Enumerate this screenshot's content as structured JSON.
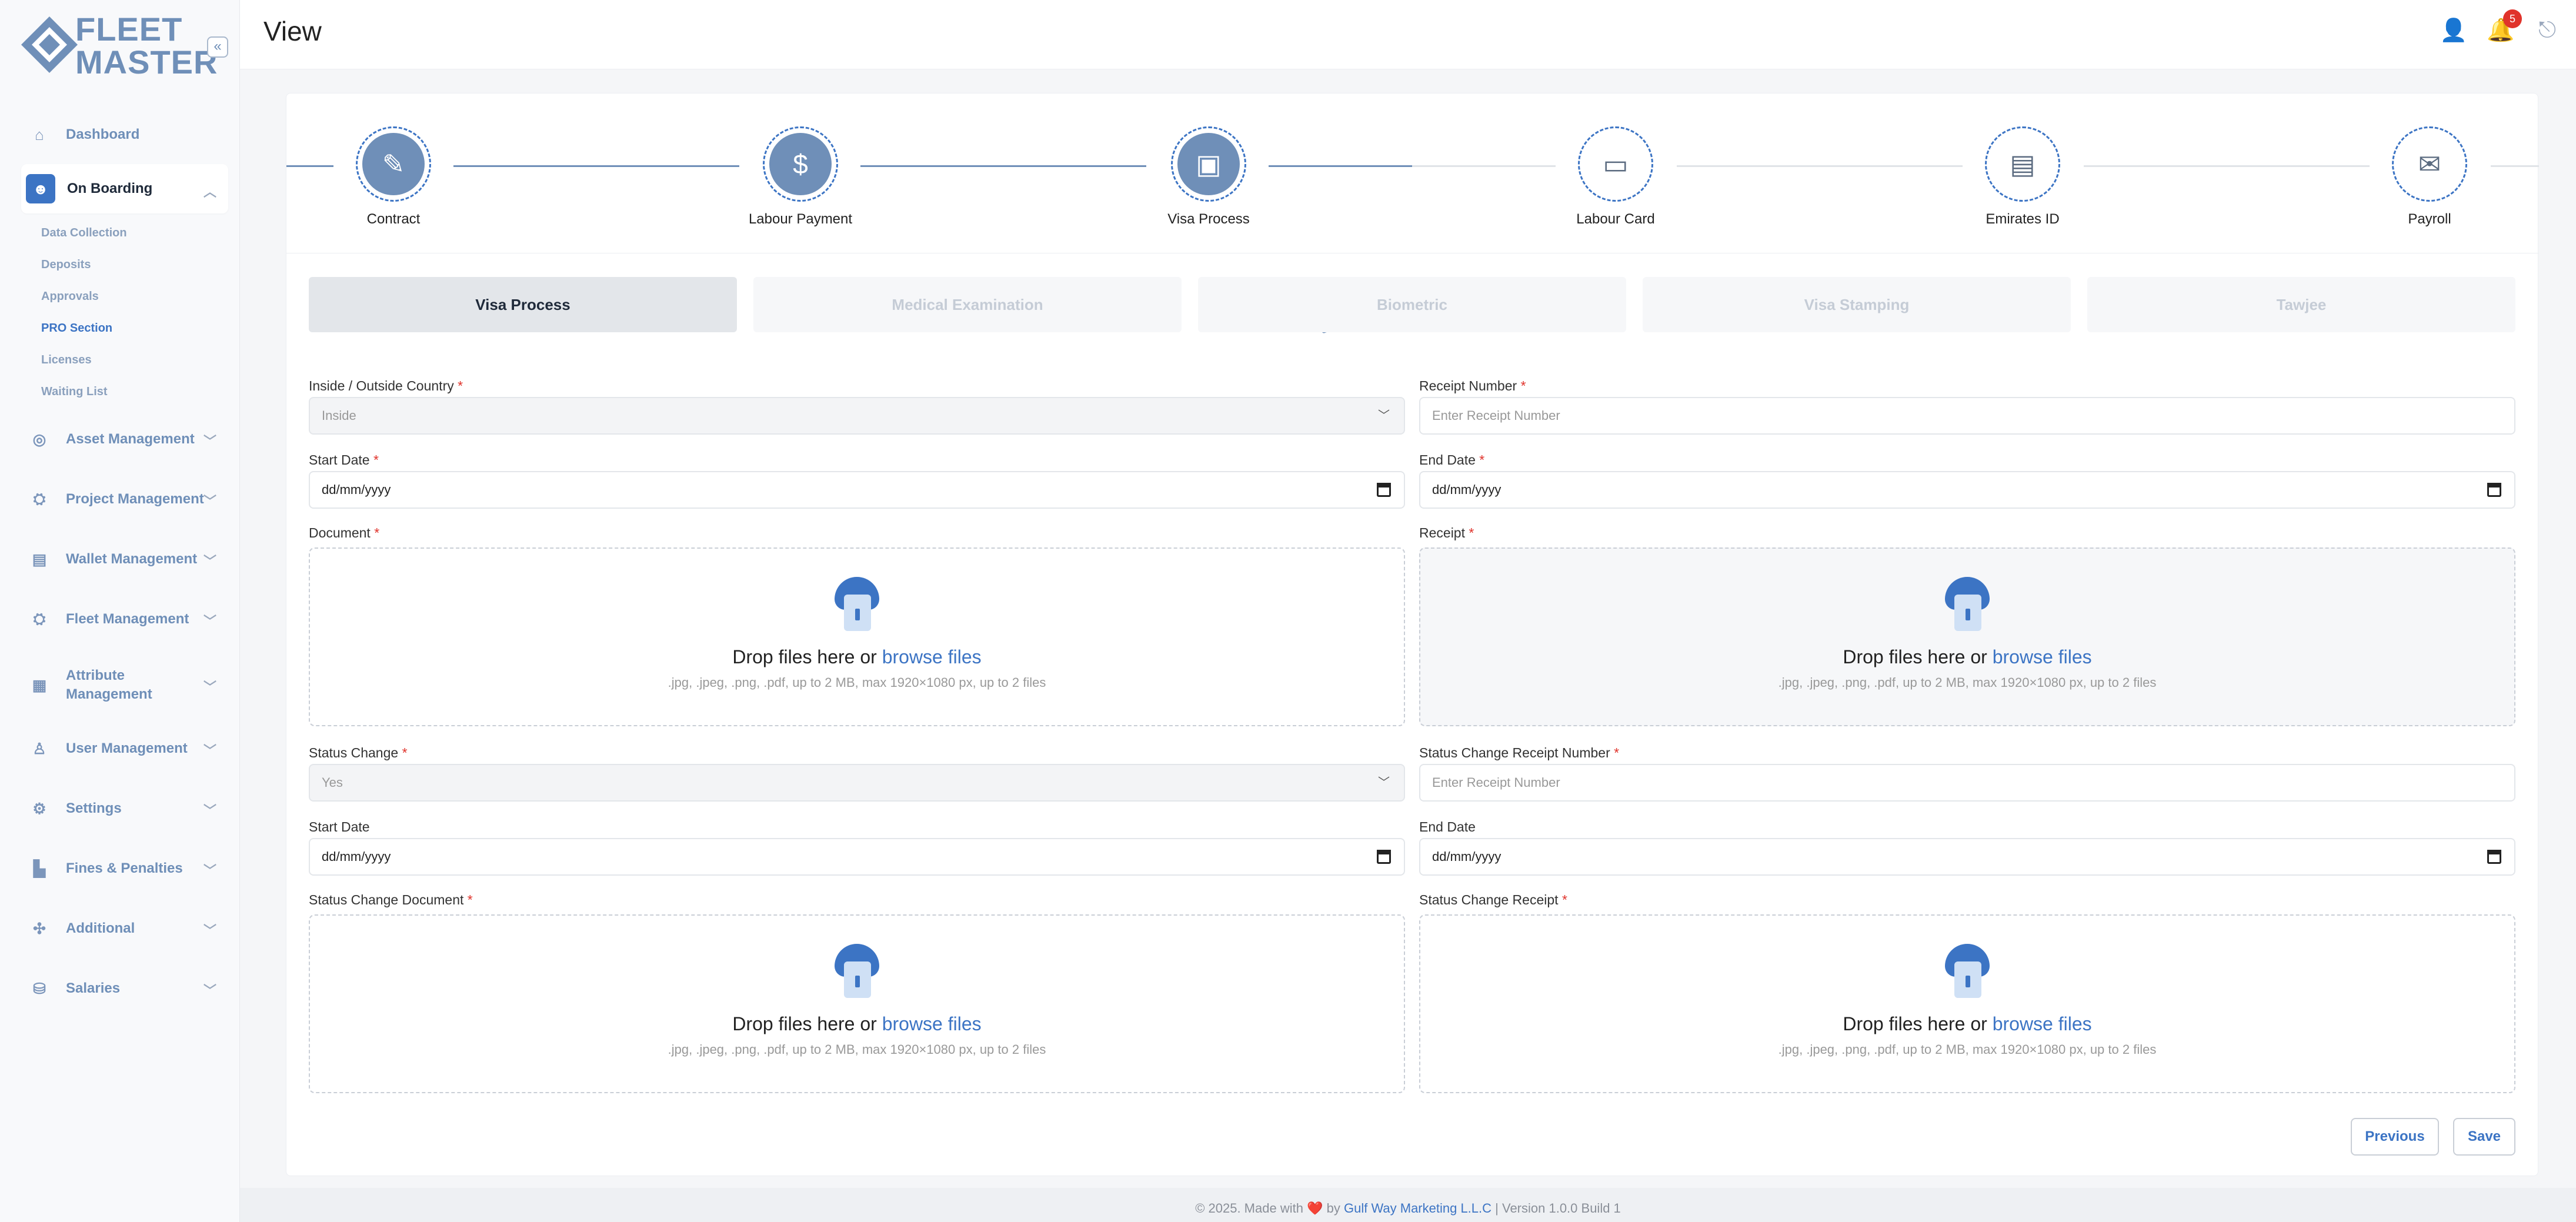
{
  "brand": {
    "line1": "FLEET",
    "line2": "MASTER",
    "accent": "#3c74c4"
  },
  "page_title": "View",
  "notifications_count": "5",
  "sidebar": {
    "items": [
      {
        "label": "Dashboard",
        "icon": "home-icon"
      },
      {
        "label": "On Boarding",
        "icon": "user-onboard-icon",
        "active": true
      },
      {
        "label": "Asset Management",
        "icon": "asset-icon"
      },
      {
        "label": "Project Management",
        "icon": "project-icon"
      },
      {
        "label": "Wallet Management",
        "icon": "wallet-icon"
      },
      {
        "label": "Fleet Management",
        "icon": "fleet-icon"
      },
      {
        "label": "Attribute Management",
        "icon": "attribute-icon"
      },
      {
        "label": "User Management",
        "icon": "users-icon"
      },
      {
        "label": "Settings",
        "icon": "gear-icon"
      },
      {
        "label": "Fines & Penalties",
        "icon": "fines-icon"
      },
      {
        "label": "Additional",
        "icon": "additional-icon"
      },
      {
        "label": "Salaries",
        "icon": "salaries-icon"
      }
    ],
    "onboarding_sub": [
      "Data Collection",
      "Deposits",
      "Approvals",
      "PRO Section",
      "Licenses",
      "Waiting List"
    ]
  },
  "steps": [
    "Contract",
    "Labour Payment",
    "Visa Process",
    "Labour Card",
    "Emirates ID",
    "Payroll"
  ],
  "tabs": [
    "Visa Process",
    "Medical Examination",
    "Biometric",
    "Visa Stamping",
    "Tawjee"
  ],
  "form": {
    "inside_outside_label": "Inside / Outside Country",
    "inside_outside_value": "Inside",
    "receipt_number_label": "Receipt Number",
    "receipt_number_placeholder": "Enter Receipt Number",
    "start_date_label": "Start Date",
    "end_date_label": "End Date",
    "date_placeholder": "dd/mm/yyyy",
    "document_label": "Document",
    "receipt_label": "Receipt",
    "status_change_label": "Status Change",
    "status_change_value": "Yes",
    "status_change_receipt_label": "Status Change Receipt Number",
    "status_change_receipt_placeholder": "Enter Receipt Number",
    "start_date2_label": "Start Date",
    "end_date2_label": "End Date",
    "status_change_document_label": "Status Change Document",
    "status_change_receipt_file_label": "Status Change Receipt",
    "required_mark": "*"
  },
  "dropzone": {
    "text": "Drop files here or",
    "browse": "browse files",
    "hint": ".jpg, .jpeg, .png, .pdf, up to 2 MB, max 1920×1080 px, up to 2 files"
  },
  "buttons": {
    "previous": "Previous",
    "save": "Save"
  },
  "footer": {
    "prefix": "© 2025. Made with",
    "heart": "❤️",
    "by": "by",
    "company": "Gulf Way Marketing L.L.C",
    "version": "| Version 1.0.0 Build 1"
  }
}
